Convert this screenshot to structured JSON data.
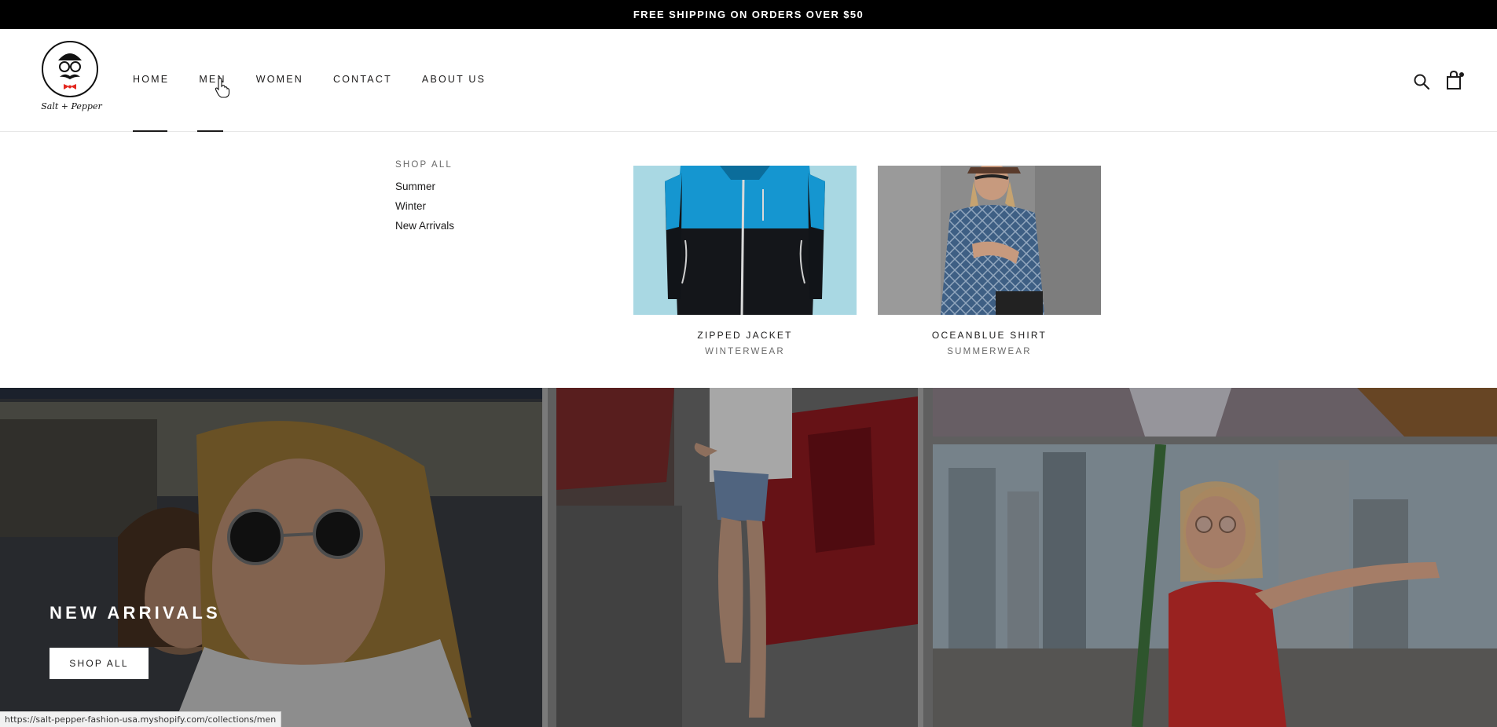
{
  "announcement": {
    "text": "FREE SHIPPING ON ORDERS OVER $50"
  },
  "brand": {
    "logo_text": "Salt + Pepper"
  },
  "nav": {
    "items": [
      {
        "label": "HOME"
      },
      {
        "label": "MEN"
      },
      {
        "label": "WOMEN"
      },
      {
        "label": "CONTACT"
      },
      {
        "label": "ABOUT US"
      }
    ],
    "active": "MEN"
  },
  "header_icons": {
    "search": "search-icon",
    "cart": "shopping-bag-icon"
  },
  "mega_menu": {
    "column_title": "SHOP ALL",
    "links": [
      "Summer",
      "Winter",
      "New Arrivals"
    ],
    "promos": [
      {
        "title": "ZIPPED JACKET",
        "subtitle": "WINTERWEAR"
      },
      {
        "title": "OCEANBLUE SHIRT",
        "subtitle": "SUMMERWEAR"
      }
    ]
  },
  "hero": {
    "title": "NEW ARRIVALS",
    "button_label": "SHOP ALL"
  },
  "status_bar": {
    "url": "https://salt-pepper-fashion-usa.myshopify.com/collections/men"
  },
  "colors": {
    "text": "#1c1b1b",
    "muted": "#6a6a6a",
    "announcement_bg": "#000000",
    "accent_bow": "#e3271f"
  }
}
